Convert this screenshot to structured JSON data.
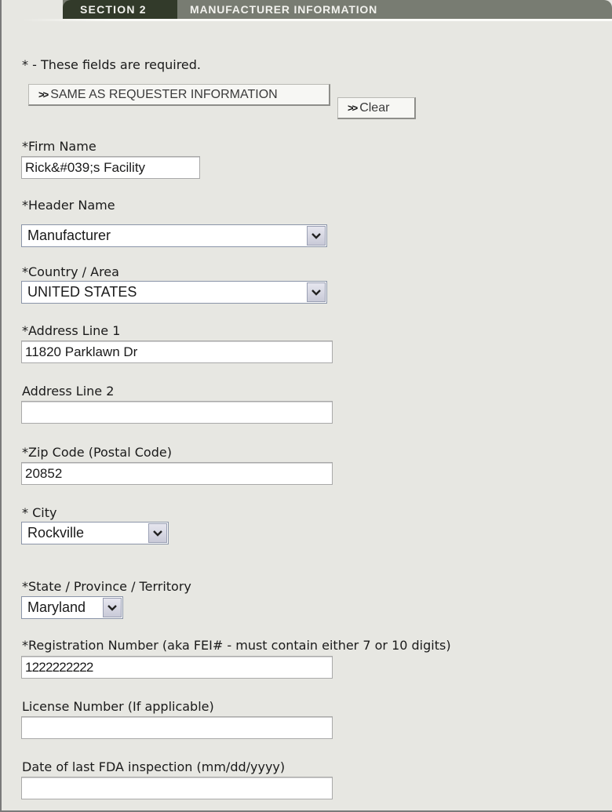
{
  "header": {
    "section_tab": "SECTION 2",
    "section_title": "MANUFACTURER INFORMATION"
  },
  "required_note": "* - These fields are required.",
  "buttons": {
    "same_as_requester": "SAME AS REQUESTER INFORMATION",
    "clear": "Clear",
    "chevron_glyph": "»"
  },
  "fields": {
    "firm_name": {
      "label": "*Firm Name",
      "value": "Rick&#039;s Facility"
    },
    "header_name": {
      "label": "*Header Name",
      "value": "Manufacturer"
    },
    "country": {
      "label": "*Country / Area",
      "value": "UNITED STATES"
    },
    "address1": {
      "label": "*Address Line 1",
      "value": "11820 Parklawn Dr"
    },
    "address2": {
      "label": "Address Line 2",
      "value": ""
    },
    "zip": {
      "label": "*Zip Code (Postal Code)",
      "value": "20852"
    },
    "city": {
      "label": "* City",
      "value": "Rockville"
    },
    "state": {
      "label": "*State / Province / Territory",
      "value": "Maryland"
    },
    "registration": {
      "label": "*Registration Number (aka FEI# - must contain either 7 or 10 digits)",
      "value": "1222222222"
    },
    "license": {
      "label": "License Number (If applicable)",
      "value": ""
    },
    "inspection_date": {
      "label": "Date of last FDA inspection (mm/dd/yyyy)",
      "value": ""
    }
  },
  "icons": {
    "dropdown": "chevron-down-icon",
    "button_prefix": "double-chevron-right-icon"
  }
}
